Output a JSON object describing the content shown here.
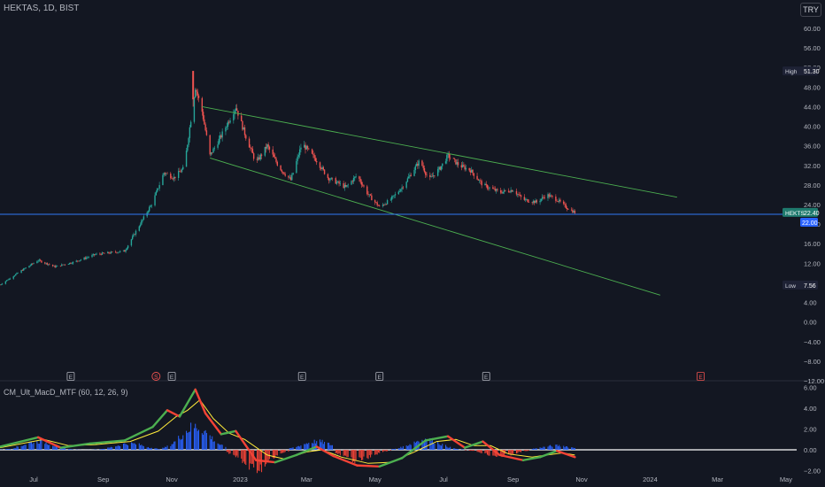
{
  "header": {
    "symbol": "HEKTAS, 1D, BIST",
    "currency": "TRY"
  },
  "oscillator": {
    "title": "CM_Ult_MacD_MTF (60, 12, 26, 9)"
  },
  "colors": {
    "background": "#131722",
    "axis_text": "#b2b5be",
    "grid": "#1e222d",
    "up": "#26a69a",
    "down": "#ef5350",
    "trendline": "#4caf50",
    "price_line": "#3179f5",
    "hist_up": "#2962ff",
    "hist_down": "#f44336",
    "macd_up": "#4caf50",
    "macd_down": "#f44336",
    "signal": "#ffeb3b"
  },
  "chart_data": [
    {
      "type": "candlestick",
      "title": "HEKTAS, 1D, BIST",
      "x_ticks": [
        "Jul",
        "Sep",
        "Nov",
        "2023",
        "Mar",
        "May",
        "Jul",
        "Sep",
        "Nov",
        "2024",
        "Mar",
        "May"
      ],
      "y_ticks": [
        60.0,
        56.0,
        52.0,
        48.0,
        44.0,
        40.0,
        36.0,
        32.0,
        28.0,
        24.0,
        20.0,
        16.0,
        12.0,
        8.0,
        4.0,
        0.0,
        -4.0,
        -8.0,
        -12.0
      ],
      "ylim": [
        -12,
        60
      ],
      "price_path": [
        {
          "date": "2022-06-01",
          "close": 7.6
        },
        {
          "date": "2022-06-20",
          "close": 10.5
        },
        {
          "date": "2022-07-05",
          "close": 12.6
        },
        {
          "date": "2022-07-20",
          "close": 11.3
        },
        {
          "date": "2022-08-05",
          "close": 12.2
        },
        {
          "date": "2022-08-25",
          "close": 13.8
        },
        {
          "date": "2022-09-20",
          "close": 14.5
        },
        {
          "date": "2022-10-05",
          "close": 20.5
        },
        {
          "date": "2022-10-15",
          "close": 24.5
        },
        {
          "date": "2022-10-25",
          "close": 30.5
        },
        {
          "date": "2022-11-03",
          "close": 29.5
        },
        {
          "date": "2022-11-12",
          "close": 31.5
        },
        {
          "date": "2022-11-22",
          "close": 48.0
        },
        {
          "date": "2022-11-28",
          "close": 43.0
        },
        {
          "date": "2022-12-05",
          "close": 34.0
        },
        {
          "date": "2022-12-15",
          "close": 38.0
        },
        {
          "date": "2022-12-28",
          "close": 44.0
        },
        {
          "date": "2023-01-05",
          "close": 38.5
        },
        {
          "date": "2023-01-15",
          "close": 32.5
        },
        {
          "date": "2023-01-25",
          "close": 36.0
        },
        {
          "date": "2023-02-05",
          "close": 31.5
        },
        {
          "date": "2023-02-15",
          "close": 29.0
        },
        {
          "date": "2023-02-25",
          "close": 36.5
        },
        {
          "date": "2023-03-10",
          "close": 33.0
        },
        {
          "date": "2023-03-20",
          "close": 29.5
        },
        {
          "date": "2023-04-05",
          "close": 27.5
        },
        {
          "date": "2023-04-15",
          "close": 30.0
        },
        {
          "date": "2023-04-25",
          "close": 26.0
        },
        {
          "date": "2023-05-05",
          "close": 23.5
        },
        {
          "date": "2023-05-15",
          "close": 25.0
        },
        {
          "date": "2023-05-25",
          "close": 27.5
        },
        {
          "date": "2023-06-10",
          "close": 33.0
        },
        {
          "date": "2023-06-18",
          "close": 29.0
        },
        {
          "date": "2023-06-28",
          "close": 31.5
        },
        {
          "date": "2023-07-05",
          "close": 34.0
        },
        {
          "date": "2023-07-15",
          "close": 32.0
        },
        {
          "date": "2023-07-25",
          "close": 31.0
        },
        {
          "date": "2023-08-05",
          "close": 28.0
        },
        {
          "date": "2023-08-20",
          "close": 26.5
        },
        {
          "date": "2023-09-01",
          "close": 27.0
        },
        {
          "date": "2023-09-10",
          "close": 25.0
        },
        {
          "date": "2023-09-22",
          "close": 24.5
        },
        {
          "date": "2023-10-01",
          "close": 26.0
        },
        {
          "date": "2023-10-10",
          "close": 25.0
        },
        {
          "date": "2023-10-18",
          "close": 23.5
        },
        {
          "date": "2023-10-26",
          "close": 22.4
        }
      ],
      "trendlines": [
        {
          "name": "upper-channel",
          "from": {
            "date": "2022-11-28",
            "price": 44.0
          },
          "to": {
            "date": "2024-01-25",
            "price": 25.5
          }
        },
        {
          "name": "lower-channel",
          "from": {
            "date": "2022-12-05",
            "price": 33.5
          },
          "to": {
            "date": "2024-01-10",
            "price": 5.5
          }
        }
      ],
      "horizontal_line": {
        "price": 22.0,
        "label": "22.00"
      },
      "price_labels": [
        {
          "text": "High",
          "value": "51.30"
        },
        {
          "text": "HEKTS",
          "value": "22.40"
        },
        {
          "text": "Low",
          "value": "7.56"
        }
      ],
      "events": [
        {
          "date": "2022-08-03",
          "type": "E"
        },
        {
          "date": "2022-10-18",
          "type": "S"
        },
        {
          "date": "2022-11-01",
          "type": "E"
        },
        {
          "date": "2023-02-25",
          "type": "E"
        },
        {
          "date": "2023-05-05",
          "type": "E"
        },
        {
          "date": "2023-08-08",
          "type": "E"
        },
        {
          "date": "2024-02-15",
          "type": "E"
        }
      ]
    },
    {
      "type": "line",
      "title": "CM_Ult_MacD_MTF (60, 12, 26, 9)",
      "y_ticks": [
        6.0,
        4.0,
        2.0,
        0.0,
        -2.0
      ],
      "ylim": [
        -3.3,
        6.2
      ],
      "macd": [
        {
          "date": "2022-06-01",
          "v": 0.3
        },
        {
          "date": "2022-07-05",
          "v": 1.2
        },
        {
          "date": "2022-07-25",
          "v": 0.2
        },
        {
          "date": "2022-08-20",
          "v": 0.6
        },
        {
          "date": "2022-09-20",
          "v": 0.9
        },
        {
          "date": "2022-10-15",
          "v": 2.2
        },
        {
          "date": "2022-10-28",
          "v": 3.8
        },
        {
          "date": "2022-11-08",
          "v": 3.2
        },
        {
          "date": "2022-11-22",
          "v": 5.8
        },
        {
          "date": "2022-12-01",
          "v": 3.5
        },
        {
          "date": "2022-12-15",
          "v": 1.5
        },
        {
          "date": "2022-12-28",
          "v": 1.8
        },
        {
          "date": "2023-01-15",
          "v": -1.0
        },
        {
          "date": "2023-02-01",
          "v": -1.2
        },
        {
          "date": "2023-02-20",
          "v": -0.5
        },
        {
          "date": "2023-03-10",
          "v": 0.3
        },
        {
          "date": "2023-03-25",
          "v": -0.6
        },
        {
          "date": "2023-04-15",
          "v": -1.5
        },
        {
          "date": "2023-05-05",
          "v": -1.6
        },
        {
          "date": "2023-05-25",
          "v": -0.8
        },
        {
          "date": "2023-06-15",
          "v": 0.9
        },
        {
          "date": "2023-07-05",
          "v": 1.3
        },
        {
          "date": "2023-07-20",
          "v": 0.2
        },
        {
          "date": "2023-08-05",
          "v": 0.8
        },
        {
          "date": "2023-08-20",
          "v": -0.5
        },
        {
          "date": "2023-09-10",
          "v": -1.0
        },
        {
          "date": "2023-09-25",
          "v": -0.7
        },
        {
          "date": "2023-10-10",
          "v": -0.1
        },
        {
          "date": "2023-10-26",
          "v": -0.7
        }
      ],
      "signal": [
        {
          "date": "2022-06-01",
          "v": 0.2
        },
        {
          "date": "2022-07-10",
          "v": 1.0
        },
        {
          "date": "2022-08-01",
          "v": 0.4
        },
        {
          "date": "2022-08-25",
          "v": 0.5
        },
        {
          "date": "2022-09-25",
          "v": 0.8
        },
        {
          "date": "2022-10-20",
          "v": 1.8
        },
        {
          "date": "2022-11-05",
          "v": 3.2
        },
        {
          "date": "2022-11-15",
          "v": 3.8
        },
        {
          "date": "2022-11-26",
          "v": 4.8
        },
        {
          "date": "2022-12-08",
          "v": 3.0
        },
        {
          "date": "2022-12-22",
          "v": 1.6
        },
        {
          "date": "2023-01-05",
          "v": 1.0
        },
        {
          "date": "2023-01-25",
          "v": -0.5
        },
        {
          "date": "2023-02-10",
          "v": -0.9
        },
        {
          "date": "2023-03-01",
          "v": -0.2
        },
        {
          "date": "2023-03-15",
          "v": 0.0
        },
        {
          "date": "2023-04-01",
          "v": -0.7
        },
        {
          "date": "2023-04-25",
          "v": -1.3
        },
        {
          "date": "2023-05-15",
          "v": -1.2
        },
        {
          "date": "2023-06-05",
          "v": -0.2
        },
        {
          "date": "2023-06-25",
          "v": 0.8
        },
        {
          "date": "2023-07-12",
          "v": 1.0
        },
        {
          "date": "2023-07-28",
          "v": 0.4
        },
        {
          "date": "2023-08-12",
          "v": 0.4
        },
        {
          "date": "2023-08-28",
          "v": -0.4
        },
        {
          "date": "2023-09-18",
          "v": -0.7
        },
        {
          "date": "2023-10-01",
          "v": -0.5
        },
        {
          "date": "2023-10-15",
          "v": -0.3
        },
        {
          "date": "2023-10-26",
          "v": -0.5
        }
      ],
      "histogram_peaks": [
        {
          "date": "2022-07-05",
          "v": 0.8
        },
        {
          "date": "2022-09-25",
          "v": 0.6
        },
        {
          "date": "2022-11-22",
          "v": 2.2
        },
        {
          "date": "2023-01-15",
          "v": -1.8
        },
        {
          "date": "2023-03-10",
          "v": 0.8
        },
        {
          "date": "2023-04-15",
          "v": -1.0
        },
        {
          "date": "2023-06-15",
          "v": 1.0
        },
        {
          "date": "2023-08-20",
          "v": -0.6
        },
        {
          "date": "2023-10-10",
          "v": 0.4
        }
      ]
    }
  ]
}
